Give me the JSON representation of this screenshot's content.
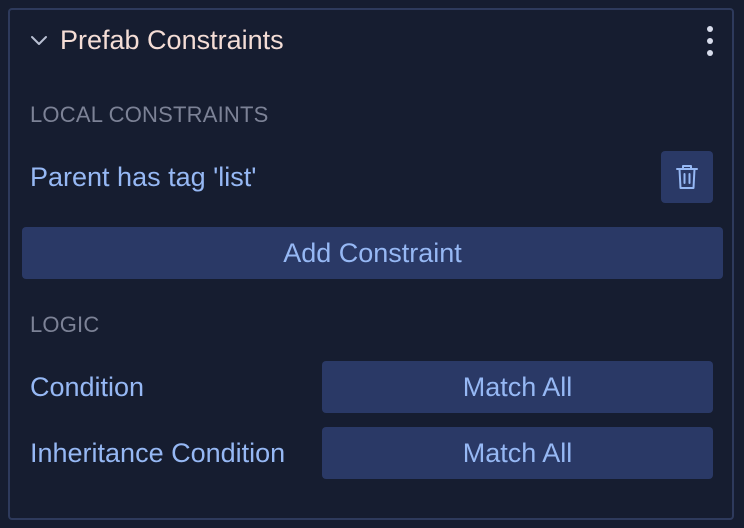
{
  "panel": {
    "title": "Prefab Constraints",
    "collapse_icon": "chevron-down-icon",
    "menu_icon": "kebab-menu-icon"
  },
  "local_constraints": {
    "heading": "LOCAL CONSTRAINTS",
    "items": [
      {
        "label": "Parent has tag 'list'",
        "delete_icon": "trash-icon"
      }
    ],
    "add_label": "Add Constraint"
  },
  "logic": {
    "heading": "LOGIC",
    "condition": {
      "label": "Condition",
      "value": "Match All"
    },
    "inheritance_condition": {
      "label": "Inheritance Condition",
      "value": "Match All"
    }
  },
  "colors": {
    "background": "#161d30",
    "border": "#2e3a5c",
    "button": "#2a3966",
    "accent_text": "#96b8f4",
    "title_text": "#f4ddd6",
    "muted_text": "#7c8296"
  }
}
